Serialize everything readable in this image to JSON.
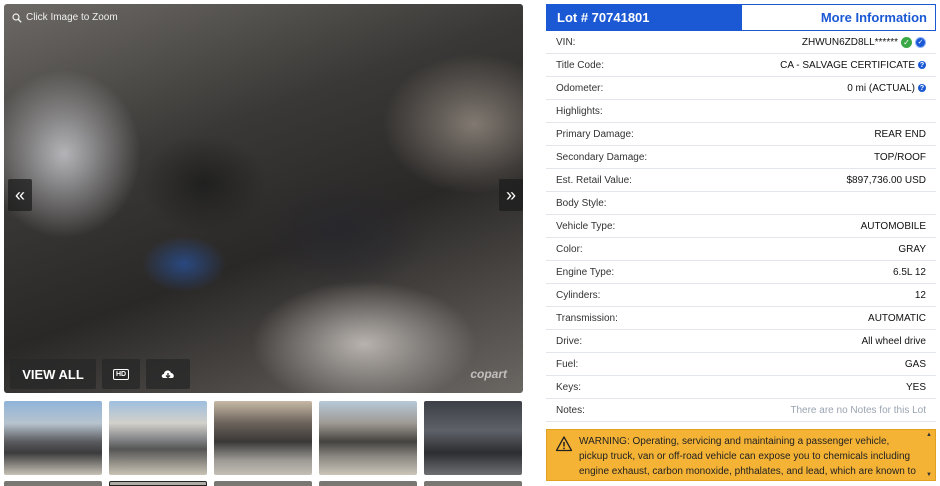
{
  "gallery": {
    "zoom_hint": "Click Image to Zoom",
    "view_all_label": "VIEW ALL",
    "hd_label": "HD",
    "watermark": "copart",
    "prev_arrow": "«",
    "next_arrow": "»"
  },
  "lot": {
    "title": "Lot # 70741801",
    "more_info_label": "More Information"
  },
  "details": [
    {
      "label": "VIN:",
      "value": "ZHWUN6ZD8LL******"
    },
    {
      "label": "Title Code:",
      "value": "CA - SALVAGE CERTIFICATE"
    },
    {
      "label": "Odometer:",
      "value": "0 mi (ACTUAL)"
    },
    {
      "label": "Highlights:",
      "value": ""
    },
    {
      "label": "Primary Damage:",
      "value": "REAR END"
    },
    {
      "label": "Secondary Damage:",
      "value": "TOP/ROOF"
    },
    {
      "label": "Est. Retail Value:",
      "value": "$897,736.00 USD"
    },
    {
      "label": "Body Style:",
      "value": ""
    },
    {
      "label": "Vehicle Type:",
      "value": "AUTOMOBILE"
    },
    {
      "label": "Color:",
      "value": "GRAY"
    },
    {
      "label": "Engine Type:",
      "value": "6.5L 12"
    },
    {
      "label": "Cylinders:",
      "value": "12"
    },
    {
      "label": "Transmission:",
      "value": "AUTOMATIC"
    },
    {
      "label": "Drive:",
      "value": "All wheel drive"
    },
    {
      "label": "Fuel:",
      "value": "GAS"
    },
    {
      "label": "Keys:",
      "value": "YES"
    },
    {
      "label": "Notes:",
      "value": "There are no Notes for this Lot"
    }
  ],
  "warning": {
    "text": "WARNING: Operating, servicing and maintaining a passenger vehicle, pickup truck, van or off-road vehicle can expose you to chemicals including engine exhaust, carbon monoxide, phthalates, and lead, which are known to the State of"
  },
  "colors": {
    "brand": "#1a58d4",
    "warning_bg": "#f5b335",
    "verified": "#39a845"
  }
}
